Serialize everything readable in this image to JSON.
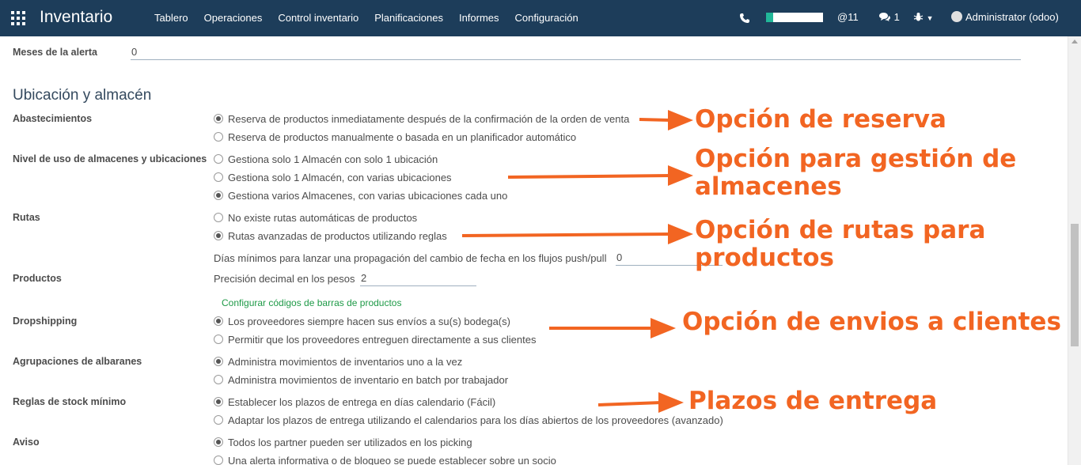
{
  "navbar": {
    "brand": "Inventario",
    "menu": [
      "Tablero",
      "Operaciones",
      "Control inventario",
      "Planificaciones",
      "Informes",
      "Configuración"
    ],
    "mentions": "@11",
    "messages": "1",
    "user": "Administrator (odoo)",
    "icons": [
      "apps-icon",
      "phone-icon",
      "chat-icon",
      "bug-icon",
      "avatar"
    ],
    "progress_fraction": 0.12
  },
  "fields": {
    "meses_alerta": {
      "label": "Meses de la alerta",
      "value": "0"
    }
  },
  "section_title": "Ubicación y almacén",
  "groups": {
    "abastecimientos": {
      "label": "Abastecimientos",
      "options": [
        {
          "label": "Reserva de productos inmediatamente después de la confirmación de la orden de venta",
          "checked": true
        },
        {
          "label": "Reserva de productos manualmente o basada en un planificador automático",
          "checked": false
        }
      ]
    },
    "nivel_uso": {
      "label": "Nivel de uso de almacenes y ubicaciones",
      "options": [
        {
          "label": "Gestiona solo 1 Almacén con solo 1 ubicación",
          "checked": false
        },
        {
          "label": "Gestiona solo 1 Almacén, con varias ubicaciones",
          "checked": false
        },
        {
          "label": "Gestiona varios Almacenes, con varias ubicaciones cada uno",
          "checked": true
        }
      ]
    },
    "rutas": {
      "label": "Rutas",
      "options": [
        {
          "label": "No existe rutas automáticas de productos",
          "checked": false
        },
        {
          "label": "Rutas avanzadas de productos utilizando reglas",
          "checked": true
        }
      ],
      "dias_label": "Días mínimos para lanzar una propagación del cambio de fecha en los flujos push/pull",
      "dias_value": "0"
    },
    "productos": {
      "label": "Productos",
      "precision_label": "Precisión decimal en los pesos",
      "precision_value": "2",
      "barcode_link": "Configurar códigos de barras de productos"
    },
    "dropshipping": {
      "label": "Dropshipping",
      "options": [
        {
          "label": "Los proveedores siempre hacen sus envíos a su(s) bodega(s)",
          "checked": true
        },
        {
          "label": "Permitir que los proveedores entreguen directamente a sus clientes",
          "checked": false
        }
      ]
    },
    "agrupaciones": {
      "label": "Agrupaciones de albaranes",
      "options": [
        {
          "label": "Administra movimientos de inventarios uno a la vez",
          "checked": true
        },
        {
          "label": "Administra movimientos de inventario en batch por trabajador",
          "checked": false
        }
      ]
    },
    "reglas_stock": {
      "label": "Reglas de stock mínimo",
      "options": [
        {
          "label": "Establecer los plazos de entrega en días calendario (Fácil)",
          "checked": true
        },
        {
          "label": "Adaptar los plazos de entrega utilizando el calendarios para los días abiertos de los proveedores (avanzado)",
          "checked": false
        }
      ]
    },
    "aviso": {
      "label": "Aviso",
      "options": [
        {
          "label": "Todos los partner pueden ser utilizados en los picking",
          "checked": true
        },
        {
          "label": "Una alerta informativa o de bloqueo se puede establecer sobre un socio",
          "checked": false
        }
      ]
    }
  },
  "annotations": {
    "reserva": "Opción de reserva",
    "gestion_1": "Opción para gestión de",
    "gestion_2": "almacenes",
    "rutas_1": "Opción de rutas para",
    "rutas_2": "productos",
    "envios": "Opción de envios a clientes",
    "plazos": "Plazos de entrega",
    "color": "#f26522"
  }
}
